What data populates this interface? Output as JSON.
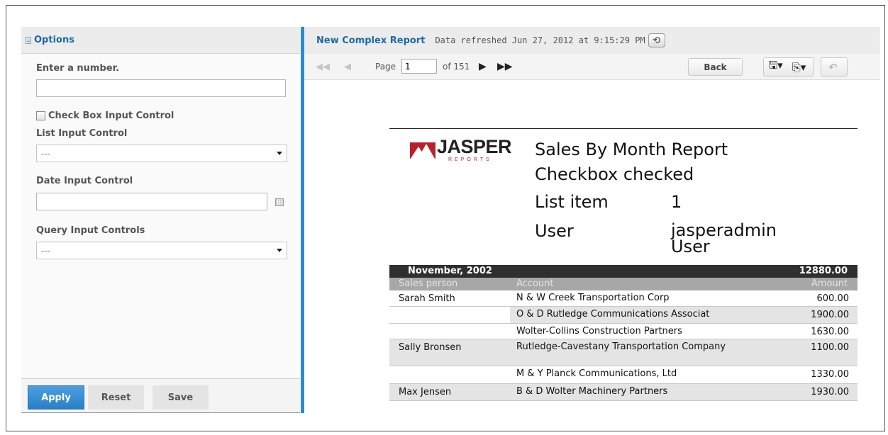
{
  "options": {
    "title": "Options",
    "number_label": "Enter a number.",
    "number_value": "",
    "checkbox_label": "Check Box Input Control",
    "list_label": "List Input Control",
    "list_value": "---",
    "date_label": "Date Input Control",
    "date_value": "",
    "query_label": "Query Input Controls",
    "query_value": "---",
    "apply_label": "Apply",
    "reset_label": "Reset",
    "save_label": "Save"
  },
  "viewer": {
    "report_title": "New Complex Report",
    "refresh_text": "Data refreshed Jun 27, 2012 at 9:15:29 PM",
    "page_label": "Page",
    "page_value": "1",
    "of_label": "of 151",
    "back_label": "Back"
  },
  "report": {
    "logo_text": "JASPER",
    "logo_sub": "REPORTS",
    "title": "Sales By Month Report",
    "checkbox_status": "Checkbox checked",
    "list_item_label": "List item",
    "list_item_value": "1",
    "user_label": "User",
    "user_value": "jasperadmin User",
    "month": "November, 2002",
    "month_total": "12880.00",
    "col_sales_person": "Sales person",
    "col_account": "Account",
    "col_amount": "Amount",
    "rows": [
      {
        "sales_person": "Sarah Smith",
        "account": "N & W Creek Transportation Corp",
        "amount": "600.00"
      },
      {
        "sales_person": "",
        "account": "O & D Rutledge Communications Associat",
        "amount": "1900.00"
      },
      {
        "sales_person": "",
        "account": "Wolter-Collins Construction Partners",
        "amount": "1630.00"
      },
      {
        "sales_person": "Sally Bronsen",
        "account": "Rutledge-Cavestany Transportation Company",
        "amount": "1100.00"
      },
      {
        "sales_person": "",
        "account": "M & Y Planck Communications, Ltd",
        "amount": "1330.00"
      },
      {
        "sales_person": "Max Jensen",
        "account": "B & D Wolter Machinery Partners",
        "amount": "1930.00"
      }
    ]
  },
  "colors": {
    "accent_blue": "#2b8ad4",
    "title_blue": "#1e6aa6",
    "jasper_red": "#b8212b",
    "month_bar": "#2f2f2f",
    "header_gray": "#a7a7a7"
  },
  "icons": [
    "options-panel-icon",
    "calendar-icon",
    "refresh-icon",
    "first-page-icon",
    "previous-page-icon",
    "next-page-icon",
    "last-page-icon",
    "save-icon",
    "export-icon",
    "undo-icon",
    "dropdown-arrow-icon"
  ]
}
